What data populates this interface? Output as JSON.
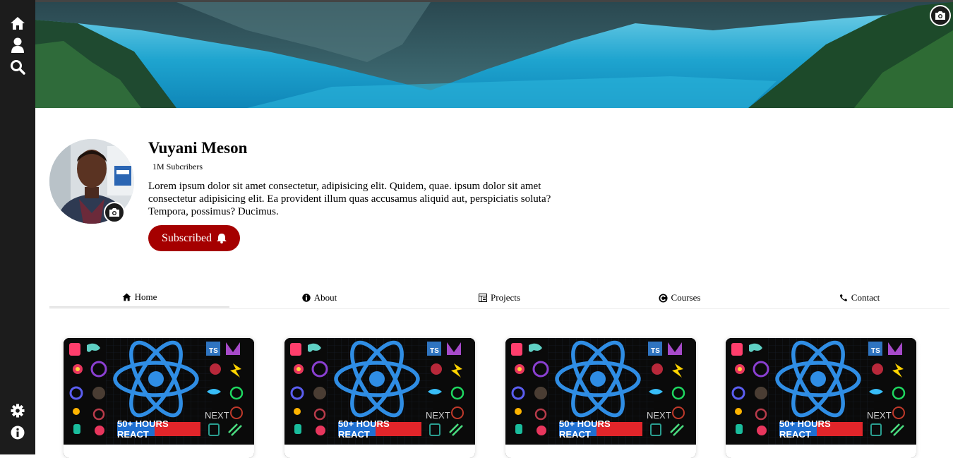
{
  "sidebar": {
    "top_icons": [
      "home-icon",
      "user-icon",
      "search-icon"
    ],
    "bottom_icons": [
      "gear-icon",
      "info-icon"
    ]
  },
  "profile": {
    "name": "Vuyani Meson",
    "subscribers": "1M Subcribers",
    "bio": "Lorem ipsum dolor sit amet consectetur, adipisicing elit. Quidem, quae. ipsum dolor sit amet consectetur adipisicing elit. Ea provident illum quas accusamus aliquid aut, perspiciatis soluta? Tempora, possimus? Ducimus.",
    "subscribe_label": "Subscribed"
  },
  "tabs": [
    {
      "label": "Home",
      "icon": "home-icon",
      "active": true
    },
    {
      "label": "About",
      "icon": "info-icon",
      "active": false
    },
    {
      "label": "Projects",
      "icon": "projects-icon",
      "active": false
    },
    {
      "label": "Courses",
      "icon": "courses-icon",
      "active": false
    },
    {
      "label": "Contact",
      "icon": "phone-icon",
      "active": false
    }
  ],
  "videos": [
    {
      "badge": "50+ HOURS REACT",
      "logo_text": "NEXT"
    },
    {
      "badge": "50+ HOURS REACT",
      "logo_text": "NEXT"
    },
    {
      "badge": "50+ HOURS REACT",
      "logo_text": "NEXT"
    },
    {
      "badge": "50+ HOURS REACT",
      "logo_text": "NEXT"
    }
  ],
  "colors": {
    "sidebar": "#1c1c1c",
    "subscribe_button": "#a50000",
    "react_blue": "#2f8de4"
  }
}
